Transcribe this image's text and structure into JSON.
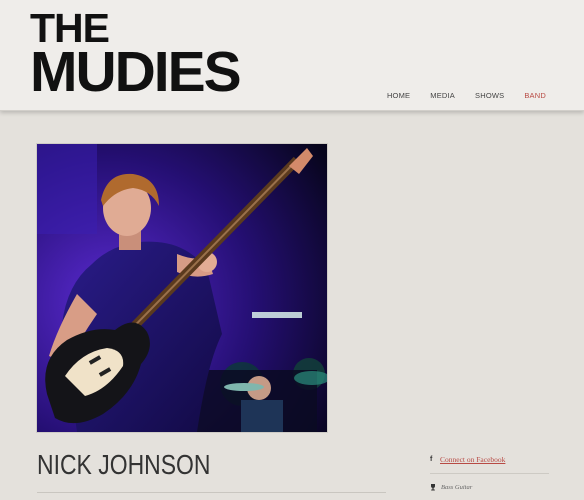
{
  "header": {
    "logo_line1": "THE",
    "logo_line2": "MUDIES",
    "logo_alt": "The Mudies"
  },
  "nav": {
    "items": [
      {
        "label": "HOME"
      },
      {
        "label": "MEDIA"
      },
      {
        "label": "SHOWS"
      },
      {
        "label": "BAND"
      }
    ],
    "active": "BAND"
  },
  "member": {
    "name": "NICK JOHNSON",
    "photo_alt": "Nick Johnson playing bass guitar on stage"
  },
  "sidebar": {
    "facebook_icon": "f",
    "facebook_label": "Connect on Facebook",
    "role": "Bass Guitar"
  },
  "colors": {
    "accent": "#b84a44",
    "background": "#e4e1dc",
    "header_bg": "#efedea",
    "text": "#333333"
  }
}
